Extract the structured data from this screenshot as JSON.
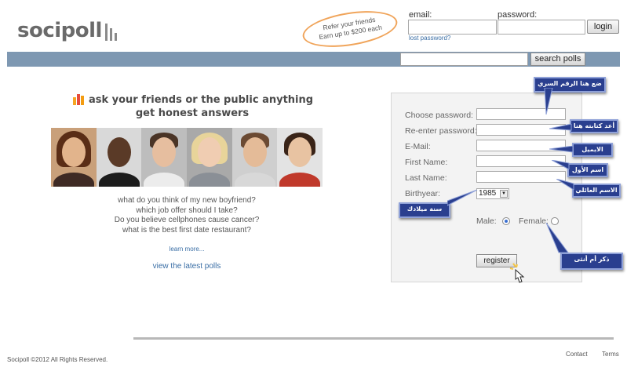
{
  "brand": {
    "name": "socipoll"
  },
  "promo": {
    "line1": "Refer your friends",
    "line2": "Earn up to $200 each"
  },
  "login": {
    "email_label": "email:",
    "password_label": "password:",
    "email_value": "",
    "password_value": "",
    "button_label": "login",
    "lost_password": "lost password?"
  },
  "search": {
    "value": "",
    "button_label": "search polls"
  },
  "hero": {
    "line1": "ask your friends or the public anything",
    "line2": "get honest answers",
    "questions": [
      "what do you think of my new boyfriend?",
      "which job offer should I take?",
      "Do you believe cellphones cause cancer?",
      "what is the best first date restaurant?"
    ],
    "learn_more": "learn more...",
    "latest_polls": "view the latest polls"
  },
  "register": {
    "choose_password": "Choose password:",
    "reenter_password": "Re-enter password:",
    "email": "E-Mail:",
    "first_name": "First Name:",
    "last_name": "Last Name:",
    "birthyear": "Birthyear:",
    "birthyear_value": "1985",
    "male": "Male:",
    "female": "Female:",
    "button_label": "register"
  },
  "annotations": {
    "password": "ضع هنا الرقم السري",
    "reenter": "أعد كتابته هنا",
    "email": "الايميل",
    "first_name": "اسم الأول",
    "last_name": "الاسم العائلي",
    "birth": "سنة ميلادك",
    "gender": "ذكر أم أنثى"
  },
  "footer": {
    "copyright": "Socipoll ©2012 All Rights Reserved.",
    "contact": "Contact",
    "terms": "Terms"
  },
  "colors": {
    "search_bar": "#7e98b2",
    "promo_border": "#f0a45a",
    "callout_bg": "#2a3f8f",
    "link": "#3a6ea5"
  }
}
